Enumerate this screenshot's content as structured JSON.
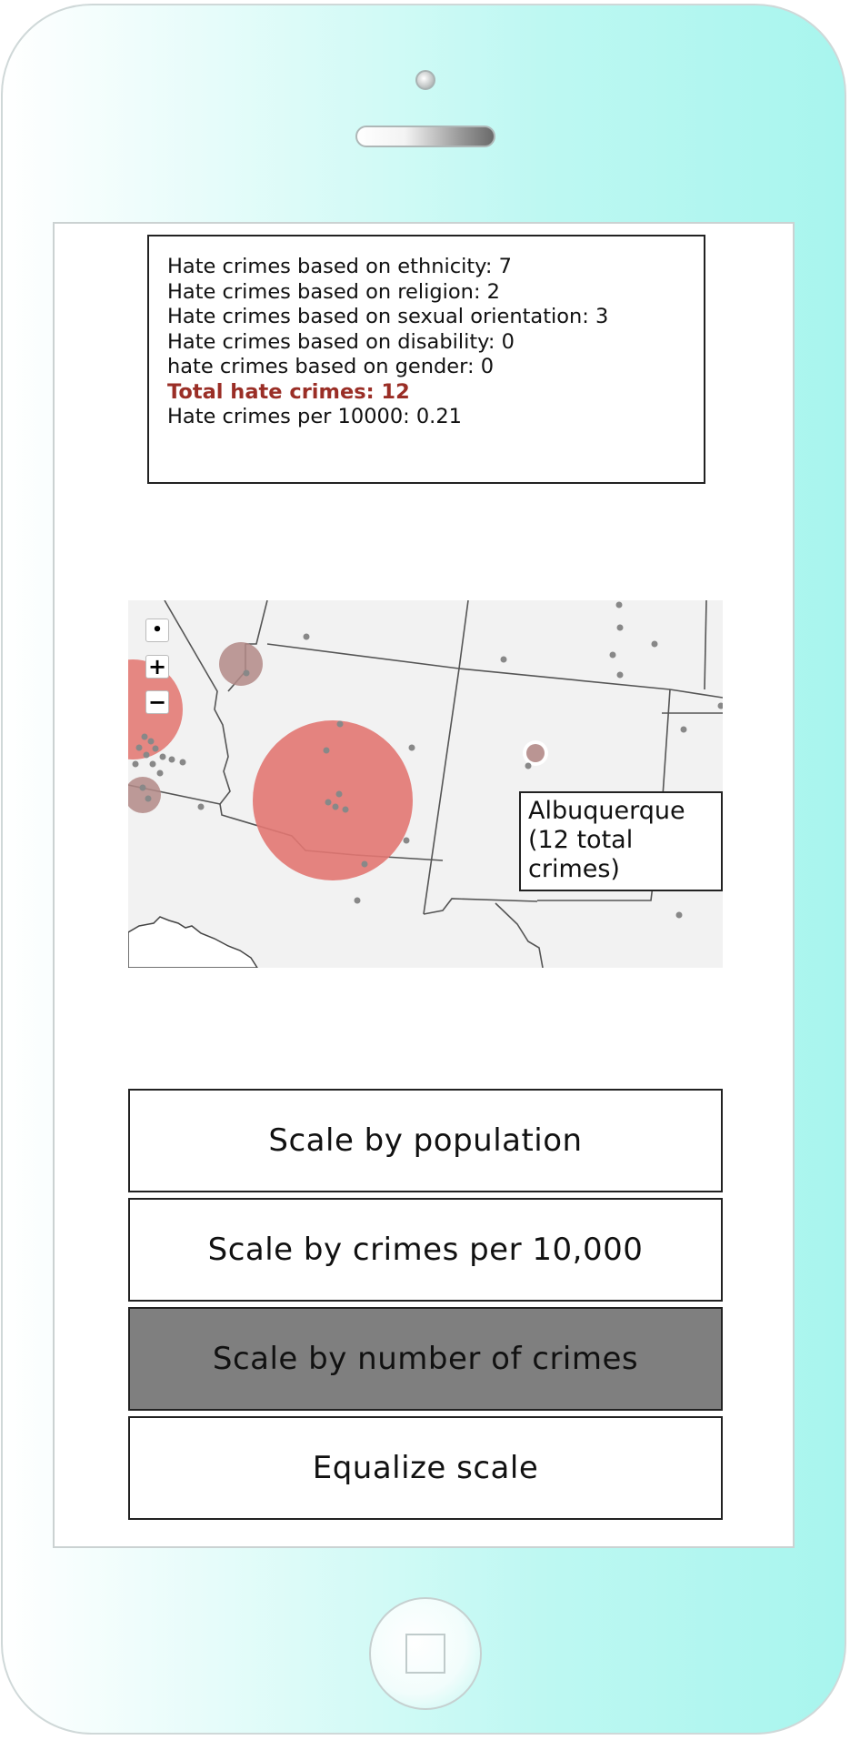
{
  "stats": {
    "ethnicity": "Hate crimes based on ethnicity: 7",
    "religion": "Hate crimes based on religion: 2",
    "sexual_orientation": "Hate crimes based on sexual orientation: 3",
    "disability": "Hate crimes based on disability: 0",
    "gender": "hate crimes based on gender: 0",
    "total": "Total hate crimes: 12",
    "per_10000": "Hate crimes per 10000: 0.21"
  },
  "map": {
    "controls": {
      "locate": "•",
      "zoom_in": "+",
      "zoom_out": "−"
    },
    "tooltip": "Albuquerque (12 total crimes)",
    "colors": {
      "land": "#f2f2f2",
      "border": "#555555",
      "large_circle": "#e27772",
      "small_circle": "#b38a87",
      "city_dot": "#888888"
    }
  },
  "buttons": {
    "population": "Scale by population",
    "per_10000": "Scale by crimes per 10,000",
    "number": "Scale by number of crimes",
    "equalize": "Equalize scale",
    "active": "Scale by number of crimes",
    "active_color": "#7f7f7f"
  }
}
